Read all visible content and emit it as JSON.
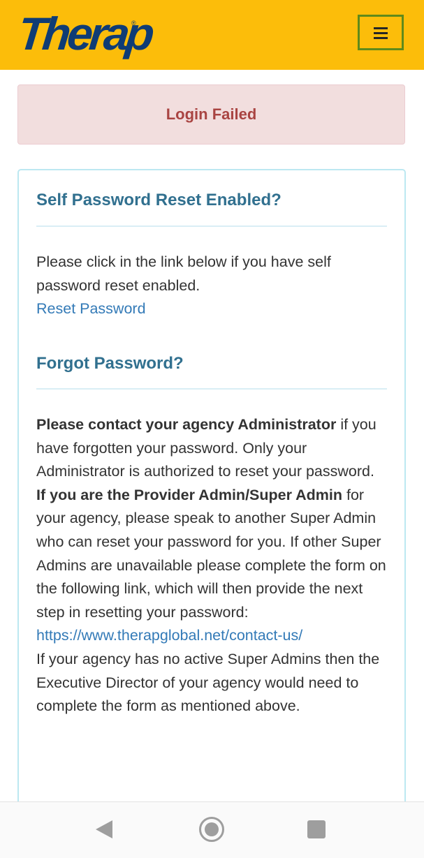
{
  "header": {
    "logo_text": "Therap",
    "logo_mark": "®",
    "menu_icon": "hamburger-menu-icon",
    "brand_color": "#fcbd0a"
  },
  "alert": {
    "message": "Login Failed",
    "color": "#a94442"
  },
  "self_reset": {
    "title": "Self Password Reset Enabled?",
    "text": "Please click in the link below if you have self password reset enabled.",
    "link_label": "Reset Password"
  },
  "forgot": {
    "title": "Forgot Password?",
    "bold_1": "Please contact your agency Administrator",
    "text_1": " if you have forgotten your password.  Only your Administrator is authorized to reset your password.",
    "bold_2": "If you are the Provider Admin/Super Admin",
    "text_2": " for your agency, please speak to another Super Admin who can reset your password for you. If other Super Admins are unavailable please complete the form on the following link, which will then provide the next step in resetting your password:",
    "link_url": "https://www.therapglobal.net/contact-us/",
    "text_3": "If your agency has no active Super Admins then the Executive Director of your agency would need to complete the form as mentioned above."
  },
  "system_nav": {
    "back_icon": "back-triangle-icon",
    "home_icon": "home-circle-icon",
    "recents_icon": "recents-square-icon"
  }
}
